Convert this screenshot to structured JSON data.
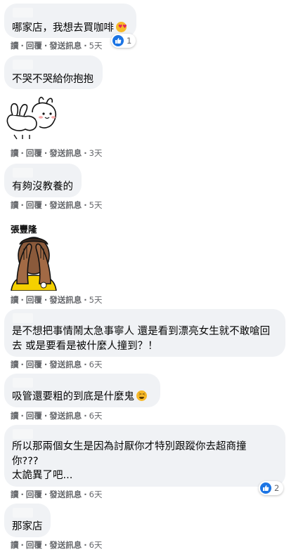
{
  "actions": {
    "read": "讀",
    "reply": "回覆",
    "message": "發送訊息",
    "sep": "·"
  },
  "comments": [
    {
      "text": "哪家店，我想去買咖啡",
      "time": "5天",
      "reaction_count": "1"
    },
    {
      "text": "不哭不哭給你抱抱",
      "time": "3天"
    },
    {
      "text": "有夠沒教養的",
      "time": "5天"
    },
    {
      "author": "張豐隆",
      "time": "5天"
    },
    {
      "line1": "是不想把事情鬧太急事寧人 還是看到漂亮女生就不敢嗆回",
      "line2": "去 或是要看是被什麼人撞到？！",
      "time": "6天"
    },
    {
      "text": "吸管還要粗的到底是什麼鬼",
      "time": "6天"
    },
    {
      "line1": "所以那兩個女生是因為討厭你才特別跟蹤你去超商撞",
      "line2": "你???",
      "line3": "太詭異了吧...",
      "time": "6天",
      "reaction_count": "2"
    },
    {
      "text": "那家店",
      "time": "6天"
    }
  ],
  "colors": {
    "bubble": "#f0f2f5",
    "meta": "#65676b",
    "like": "#1b74e4"
  }
}
